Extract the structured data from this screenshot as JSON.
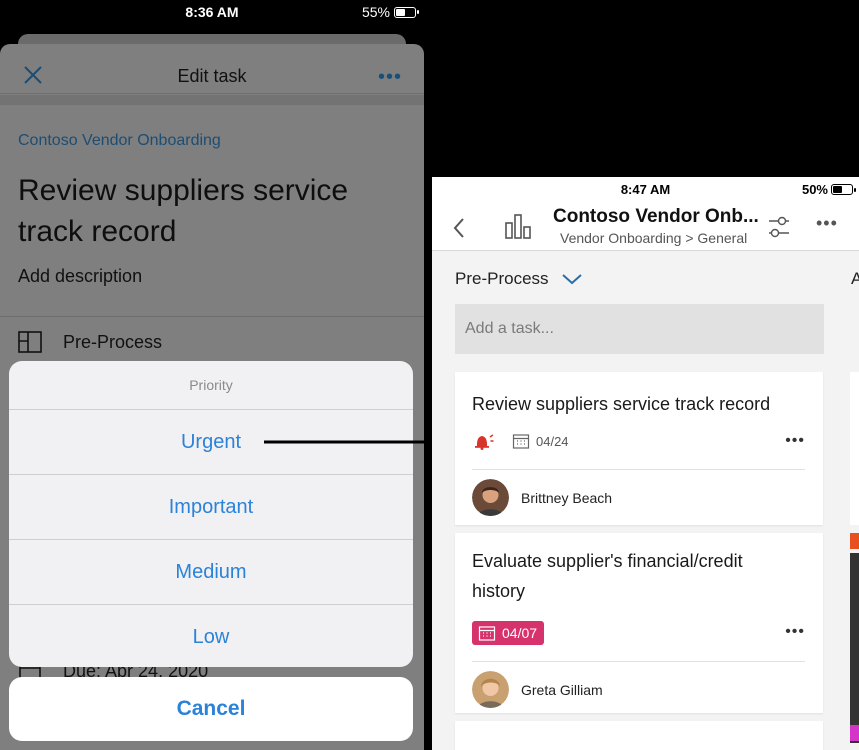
{
  "left_screen": {
    "status_bar": {
      "time": "8:36 AM",
      "battery": "55%",
      "battery_level": 0.55
    },
    "header": {
      "title": "Edit task"
    },
    "plan_name": "Contoso Vendor Onboarding",
    "task_title": "Review suppliers service track record",
    "description_placeholder": "Add description",
    "bucket": "Pre-Process",
    "due_date": "Due: Apr 24, 2020",
    "priority_sheet": {
      "title": "Priority",
      "options": [
        "Urgent",
        "Important",
        "Medium",
        "Low"
      ],
      "cancel": "Cancel"
    }
  },
  "right_screen": {
    "status_bar": {
      "time": "8:47 AM",
      "battery": "50%",
      "battery_level": 0.5
    },
    "header": {
      "plan_title": "Contoso Vendor Onb...",
      "breadcrumb_group": "Vendor Onboarding",
      "breadcrumb_channel": "General"
    },
    "bucket_name": "Pre-Process",
    "next_bucket_initial": "A",
    "add_task_placeholder": "Add a task...",
    "cards": [
      {
        "title": "Review suppliers service track record",
        "priority_icon": "urgent-bell-icon",
        "due": "04/24",
        "due_overdue": false,
        "assignee": "Brittney Beach"
      },
      {
        "title": "Evaluate supplier's financial/credit history",
        "due": "04/07",
        "due_overdue": true,
        "assignee": "Greta Gilliam"
      }
    ],
    "colors": {
      "accent": "#2b82d9",
      "urgent": "#d9342b",
      "overdue": "#d6336c"
    }
  }
}
